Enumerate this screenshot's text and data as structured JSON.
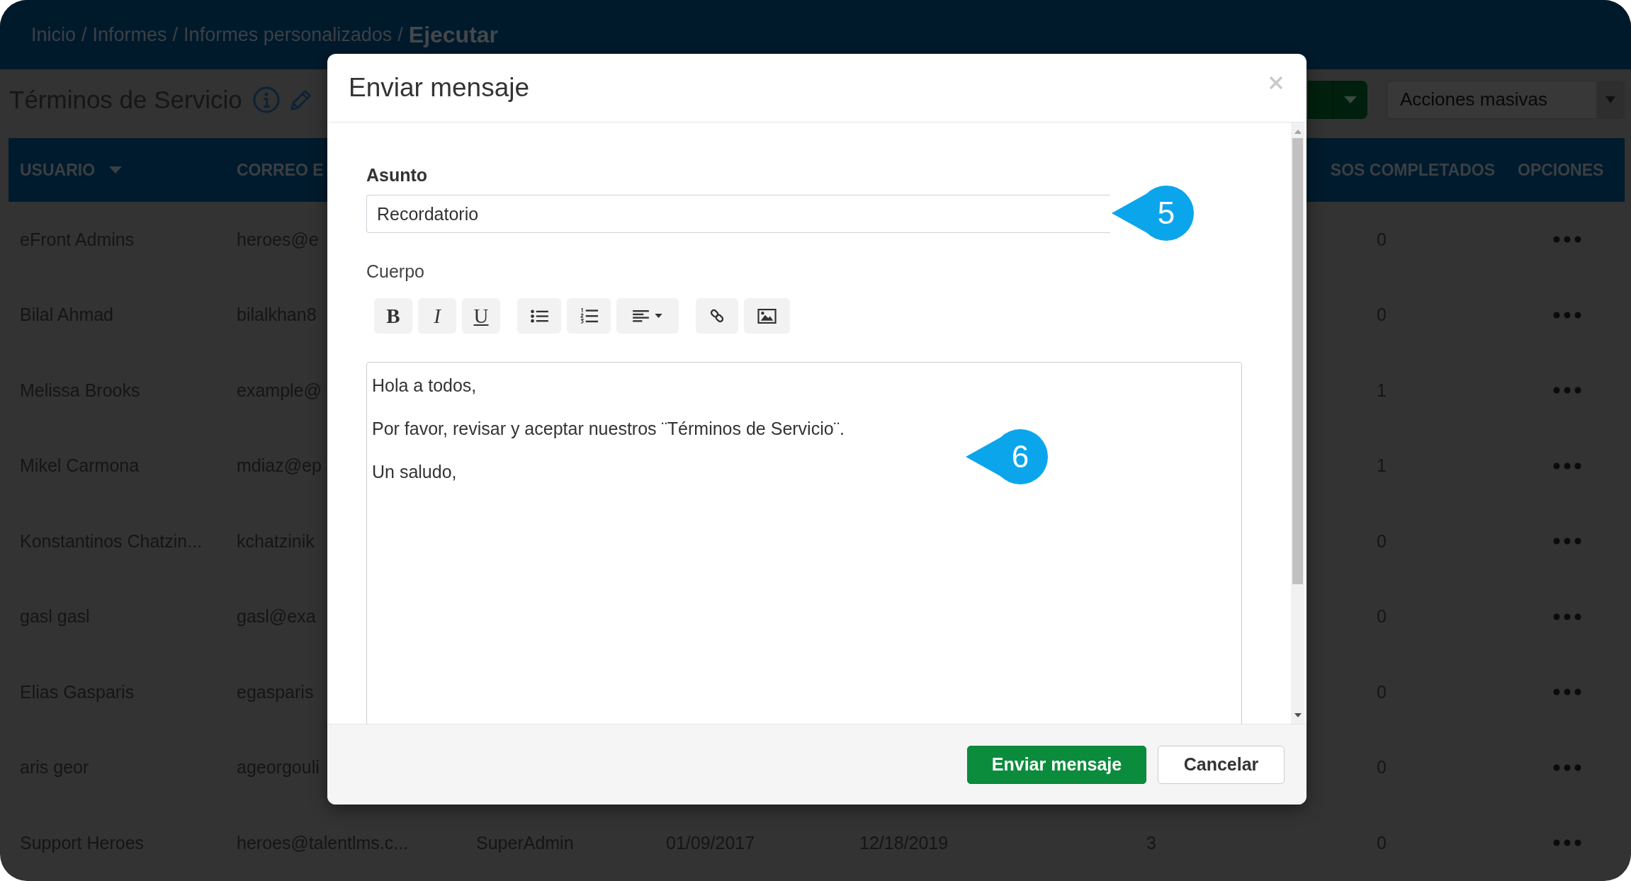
{
  "breadcrumb": {
    "links": [
      {
        "label": "Inicio",
        "separator": "/"
      },
      {
        "label": "Informes",
        "separator": "/"
      },
      {
        "label": "Informes personalizados",
        "separator": "/"
      }
    ],
    "current": "Ejecutar"
  },
  "page": {
    "title": "Términos de Servicio",
    "bulk_actions": {
      "value": "Acciones masivas"
    }
  },
  "table": {
    "columns": {
      "user": {
        "label": "USUARIO",
        "sorted": true
      },
      "email": {
        "label": "CORREO E"
      },
      "completed": {
        "label": "SOS COMPLETADOS"
      },
      "options": {
        "label": "OPCIONES"
      }
    },
    "rows": [
      {
        "user": "eFront Admins",
        "email": "heroes@e",
        "completed": "0"
      },
      {
        "user": "Bilal Ahmad",
        "email": "bilalkhan8",
        "completed": "0"
      },
      {
        "user": "Melissa Brooks",
        "email": "example@",
        "completed": "1"
      },
      {
        "user": "Mikel Carmona",
        "email": "mdiaz@ep",
        "completed": "1"
      },
      {
        "user": "Konstantinos Chatzin...",
        "email": "kchatzinik",
        "completed": "0"
      },
      {
        "user": "gasl gasl",
        "email": "gasl@exa",
        "completed": "0"
      },
      {
        "user": "Elias Gasparis",
        "email": "egasparis",
        "completed": "0"
      },
      {
        "user": "aris geor",
        "email": "ageorgouli",
        "completed": "0"
      },
      {
        "user": "Support Heroes",
        "email": "heroes@talentlms.c...",
        "column_3": "SuperAdmin",
        "column_4": "01/09/2017",
        "column_5": "12/18/2019",
        "column_6": "3",
        "completed": "0"
      }
    ]
  },
  "modal": {
    "title": "Enviar mensaje",
    "subject": {
      "label": "Asunto",
      "value": "Recordatorio"
    },
    "body": {
      "label": "Cuerpo",
      "toolbar": [
        {
          "buttons": [
            {
              "kind": "bold",
              "label": "B"
            },
            {
              "kind": "italic",
              "label": "I"
            },
            {
              "kind": "underline",
              "label": "U"
            }
          ]
        },
        {
          "buttons": [
            {
              "kind": "bullets"
            },
            {
              "kind": "numbered"
            },
            {
              "kind": "align"
            }
          ]
        },
        {
          "buttons": [
            {
              "kind": "link"
            },
            {
              "kind": "image"
            }
          ]
        }
      ],
      "paragraphs": [
        "Hola a todos,",
        "Por favor, revisar y aceptar nuestros ¨Términos de Servicio¨.",
        "Un saludo,"
      ]
    },
    "buttons": [
      {
        "kind": "primary",
        "label": "Enviar mensaje"
      },
      {
        "kind": "default",
        "label": "Cancelar"
      }
    ]
  },
  "callouts": [
    {
      "number": "5"
    },
    {
      "number": "6"
    }
  ]
}
